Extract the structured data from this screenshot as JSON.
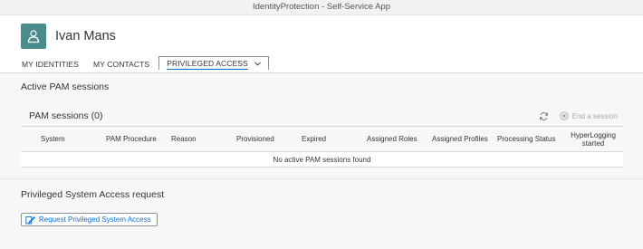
{
  "window": {
    "title": "IdentityProtection - Self-Service App"
  },
  "user": {
    "name": "Ivan Mans"
  },
  "tabs": [
    {
      "label": "MY IDENTITIES"
    },
    {
      "label": "MY CONTACTS"
    },
    {
      "label": "PRIVILEGED ACCESS",
      "selected": true
    }
  ],
  "active_sessions": {
    "title": "Active PAM sessions",
    "panel_title": "PAM sessions (0)",
    "end_session_label": "End a session",
    "columns": [
      "System",
      "PAM Procedure",
      "Reason",
      "Provisioned",
      "Expired",
      "Assigned Roles",
      "Assigned Profiles",
      "Processing Status",
      "HyperLogging started"
    ],
    "empty_text": "No active PAM sessions found"
  },
  "request": {
    "title": "Privileged System Access request",
    "button_label": "Request Privileged System Access"
  },
  "colors": {
    "accent": "#0a6ed1",
    "avatar_bg": "#4a8b8b",
    "disabled": "#a6aaad"
  },
  "icons": {
    "avatar": "person-icon",
    "tab_dropdown": "chevron-down-icon",
    "refresh": "refresh-icon",
    "end_session": "stop-circle-icon",
    "request": "request-edit-icon"
  }
}
